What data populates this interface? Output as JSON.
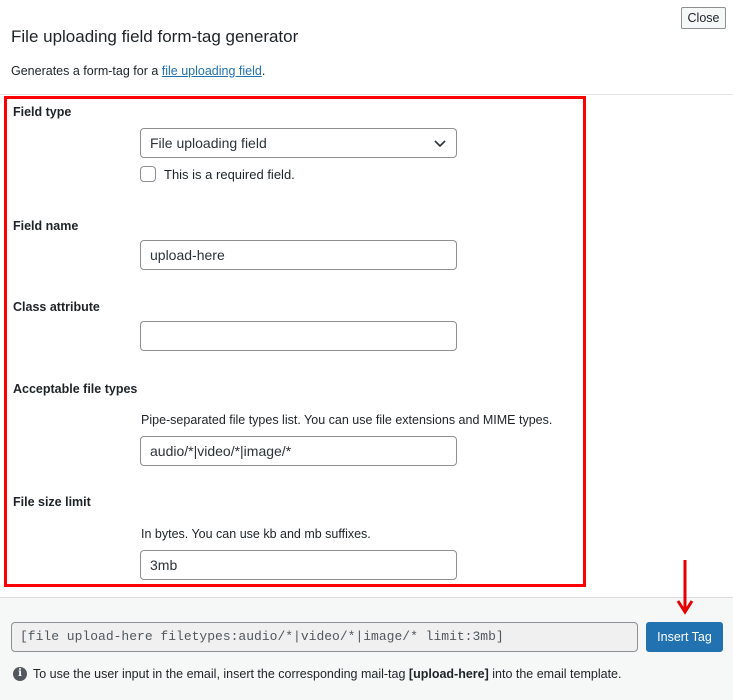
{
  "header": {
    "title": "File uploading field form-tag generator",
    "close_label": "Close",
    "description_prefix": "Generates a form-tag for a ",
    "description_link": "file uploading field",
    "description_suffix": "."
  },
  "fields": {
    "field_type": {
      "label": "Field type",
      "selected": "File uploading field",
      "required_checkbox_label": "This is a required field.",
      "required_checked": false
    },
    "field_name": {
      "label": "Field name",
      "value": "upload-here"
    },
    "class_attribute": {
      "label": "Class attribute",
      "value": ""
    },
    "file_types": {
      "label": "Acceptable file types",
      "help": "Pipe-separated file types list. You can use file extensions and MIME types.",
      "value": "audio/*|video/*|image/*"
    },
    "file_size": {
      "label": "File size limit",
      "help": "In bytes. You can use kb and mb suffixes.",
      "value": "3mb"
    }
  },
  "footer": {
    "tag_output": "[file upload-here filetypes:audio/*|video/*|image/* limit:3mb]",
    "insert_label": "Insert Tag",
    "note_prefix": "To use the user input in the email, insert the corresponding mail-tag ",
    "note_tag": "[upload-here]",
    "note_suffix": " into the email template."
  },
  "annotations": {
    "highlight_color": "#ff0000",
    "accent_color": "#2271b1"
  }
}
